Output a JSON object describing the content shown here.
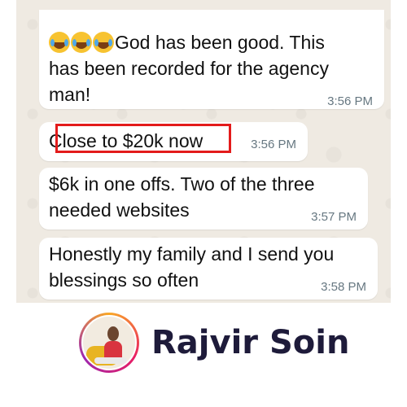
{
  "messages": [
    {
      "emoji": [
        "face-with-tears-of-joy",
        "face-with-tears-of-joy",
        "face-with-tears-of-joy"
      ],
      "lines": [
        "God has been good. This",
        "has been recorded for the agency",
        "man!"
      ],
      "time": "3:56 PM"
    },
    {
      "lines": [
        "Close to $20k now"
      ],
      "time": "3:56 PM",
      "highlighted": true,
      "highlight_color": "#e31b1b"
    },
    {
      "lines": [
        "$6k in one offs. Two of the three",
        "needed websites"
      ],
      "time": "3:57 PM"
    },
    {
      "lines": [
        "Honestly my family and I send you",
        "blessings so often"
      ],
      "time": "3:58 PM"
    }
  ],
  "profile": {
    "name": "Rajvir Soin",
    "avatar_icon": "profile-photo"
  },
  "colors": {
    "chat_background": "#efeae2",
    "bubble": "#ffffff",
    "timestamp": "#667781",
    "name_text": "#1e1b3a"
  }
}
